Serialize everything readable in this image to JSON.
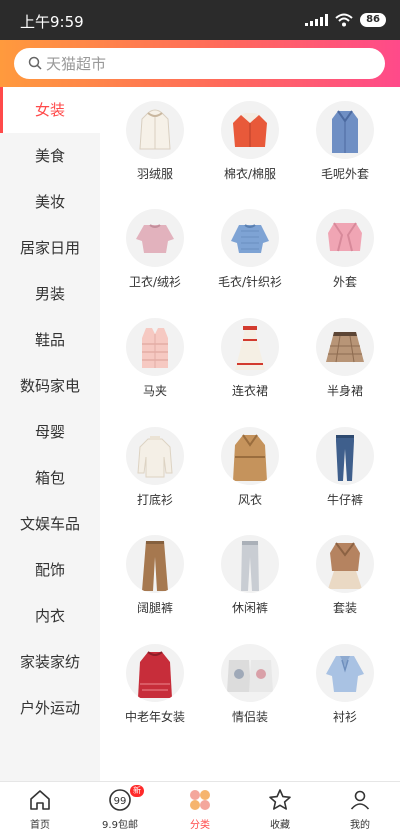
{
  "status_bar": {
    "time": "上午9:59",
    "battery": "86"
  },
  "search": {
    "placeholder": "天猫超市"
  },
  "sidebar": {
    "items": [
      {
        "label": "女装",
        "active": true
      },
      {
        "label": "美食"
      },
      {
        "label": "美妆"
      },
      {
        "label": "居家日用"
      },
      {
        "label": "男装"
      },
      {
        "label": "鞋品"
      },
      {
        "label": "数码家电"
      },
      {
        "label": "母婴"
      },
      {
        "label": "箱包"
      },
      {
        "label": "文娱车品"
      },
      {
        "label": "配饰"
      },
      {
        "label": "内衣"
      },
      {
        "label": "家装家纺"
      },
      {
        "label": "户外运动"
      }
    ]
  },
  "products": [
    {
      "label": "羽绒服",
      "icon": "down-jacket-icon"
    },
    {
      "label": "棉衣/棉服",
      "icon": "cotton-coat-icon"
    },
    {
      "label": "毛呢外套",
      "icon": "wool-coat-icon"
    },
    {
      "label": "卫衣/绒衫",
      "icon": "sweatshirt-icon"
    },
    {
      "label": "毛衣/针织衫",
      "icon": "sweater-icon"
    },
    {
      "label": "外套",
      "icon": "jacket-icon"
    },
    {
      "label": "马夹",
      "icon": "vest-icon"
    },
    {
      "label": "连衣裙",
      "icon": "dress-icon"
    },
    {
      "label": "半身裙",
      "icon": "skirt-icon"
    },
    {
      "label": "打底衫",
      "icon": "base-shirt-icon"
    },
    {
      "label": "风衣",
      "icon": "trench-coat-icon"
    },
    {
      "label": "牛仔裤",
      "icon": "jeans-icon"
    },
    {
      "label": "阔腿裤",
      "icon": "wide-pants-icon"
    },
    {
      "label": "休闲裤",
      "icon": "casual-pants-icon"
    },
    {
      "label": "套装",
      "icon": "suit-set-icon"
    },
    {
      "label": "中老年女装",
      "icon": "elder-clothing-icon"
    },
    {
      "label": "情侣装",
      "icon": "couple-wear-icon"
    },
    {
      "label": "衬衫",
      "icon": "blouse-icon"
    }
  ],
  "tabbar": {
    "items": [
      {
        "label": "首页",
        "icon": "home-icon"
      },
      {
        "label": "9.9包邮",
        "icon": "coin-99-icon",
        "badge": "新"
      },
      {
        "label": "分类",
        "icon": "category-icon",
        "active": true
      },
      {
        "label": "收藏",
        "icon": "star-icon"
      },
      {
        "label": "我的",
        "icon": "user-icon"
      }
    ]
  },
  "colors": {
    "accent": "#ff4a4a",
    "header_gradient": [
      "#ff9a3d",
      "#ff6a5a",
      "#ff4a8a"
    ],
    "status_bar": "#2b2b2b",
    "sidebar_bg": "#f5f5f5"
  }
}
